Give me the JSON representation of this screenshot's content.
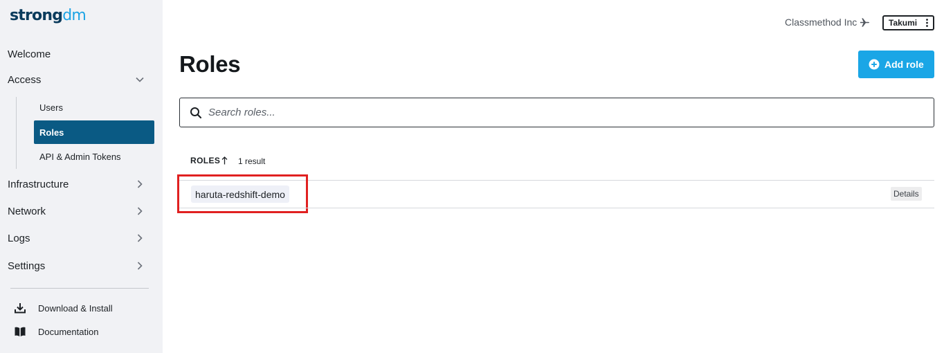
{
  "brand": {
    "logo_prefix": "strong",
    "logo_suffix": "dm"
  },
  "sidebar": {
    "items": [
      {
        "label": "Welcome"
      },
      {
        "label": "Access",
        "chevron": "chevron-down-icon"
      },
      {
        "label": "Infrastructure",
        "chevron": "chevron-right-icon"
      },
      {
        "label": "Network",
        "chevron": "chevron-right-icon"
      },
      {
        "label": "Logs",
        "chevron": "chevron-right-icon"
      },
      {
        "label": "Settings",
        "chevron": "chevron-right-icon"
      }
    ],
    "access_sub": [
      {
        "label": "Users",
        "active": false
      },
      {
        "label": "Roles",
        "active": true
      },
      {
        "label": "API & Admin Tokens",
        "active": false
      }
    ],
    "utilities": [
      {
        "label": "Download & Install",
        "icon": "download-icon"
      },
      {
        "label": "Documentation",
        "icon": "book-icon"
      }
    ]
  },
  "header": {
    "org_name": "Classmethod Inc",
    "org_icon": "airplane-icon",
    "user_label": "Takumi",
    "user_menu_icon": "kebab-icon"
  },
  "page": {
    "title": "Roles",
    "add_button_label": "Add role",
    "add_button_icon": "plus-circle-icon"
  },
  "search": {
    "placeholder": "Search roles...",
    "value": ""
  },
  "table": {
    "column_label": "ROLES",
    "sort_icon": "arrow-up-icon",
    "result_count": "1 result",
    "rows": [
      {
        "name": "haruta-redshift-demo",
        "action_label": "Details"
      }
    ]
  },
  "colors": {
    "sidebar_bg": "#f1f2f5",
    "active_nav": "#0a5a84",
    "primary_button": "#1aa6e6",
    "highlight_border": "#e02020",
    "brand_dark": "#0a3b5c",
    "brand_accent": "#1ca3e4"
  }
}
